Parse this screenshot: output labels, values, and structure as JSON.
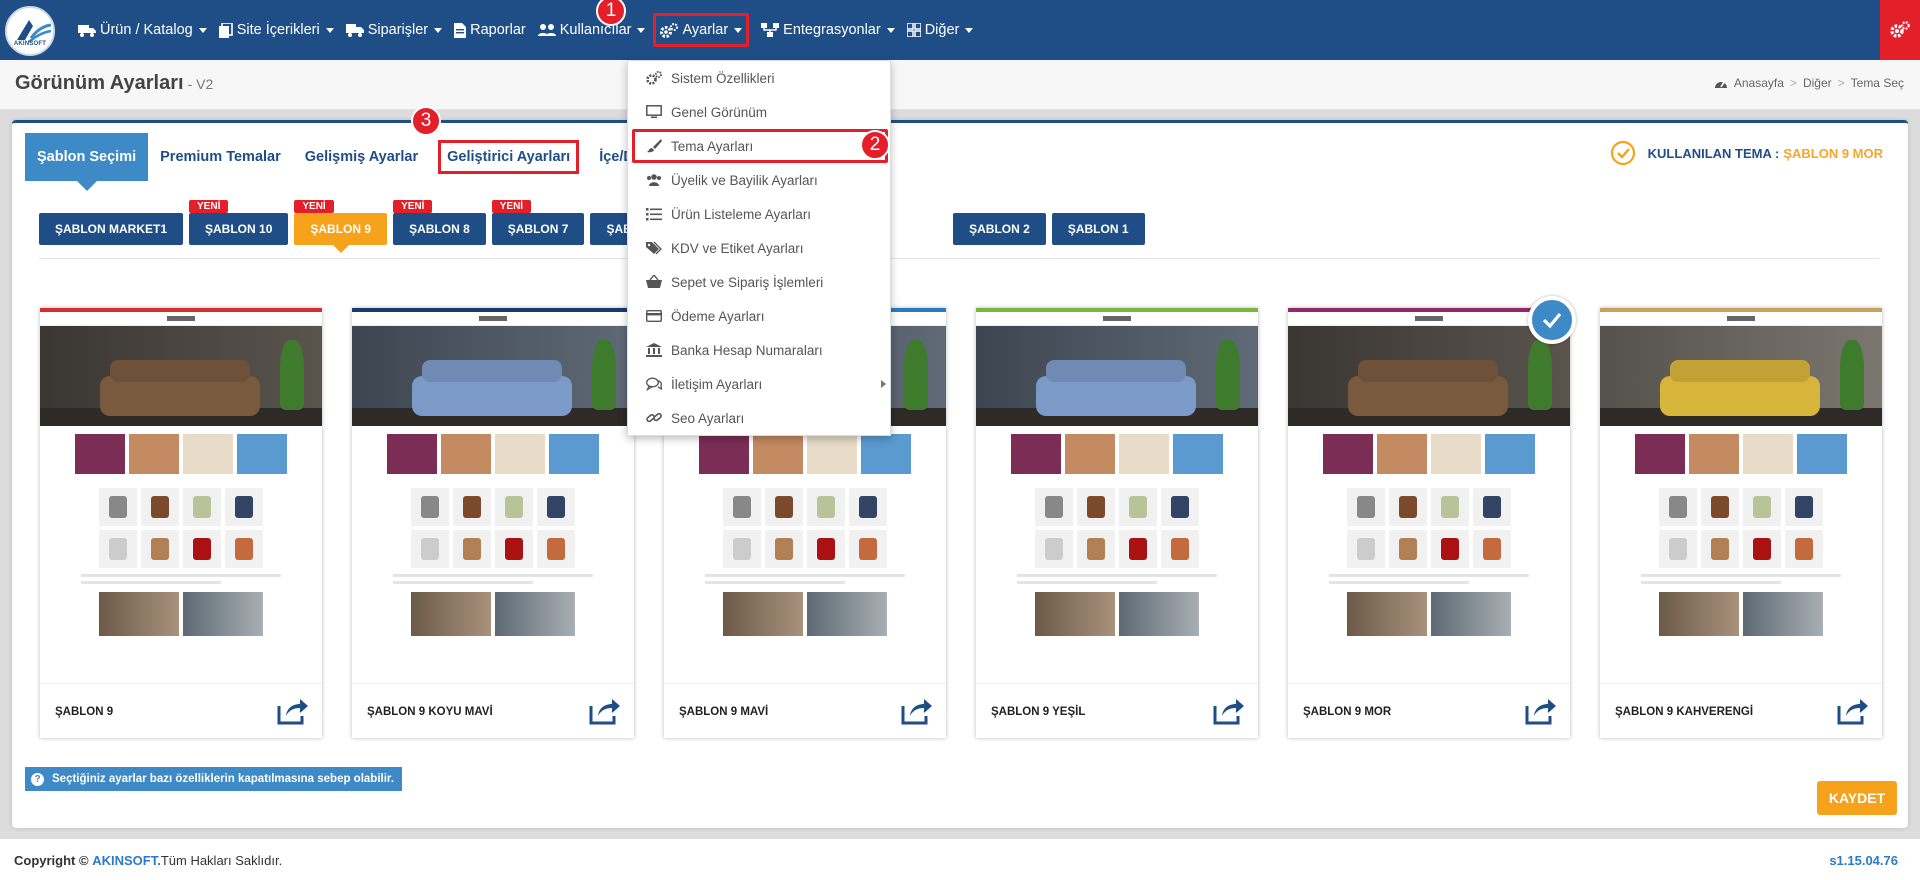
{
  "nav": {
    "logo_text": "AKINSOFT",
    "items": [
      {
        "label": "Ürün / Katalog"
      },
      {
        "label": "Site İçerikleri"
      },
      {
        "label": "Siparişler"
      },
      {
        "label": "Raporlar"
      },
      {
        "label": "Kullanıcılar"
      },
      {
        "label": "Ayarlar"
      },
      {
        "label": "Entegrasyonlar"
      },
      {
        "label": "Diğer"
      }
    ]
  },
  "page": {
    "title": "Görünüm Ayarları",
    "version_tag": "- V2"
  },
  "breadcrumb": [
    "Anasayfa",
    "Diğer",
    "Tema Seç"
  ],
  "tabs": [
    {
      "label": "Şablon Seçimi"
    },
    {
      "label": "Premium Temalar"
    },
    {
      "label": "Gelişmiş Ayarlar"
    },
    {
      "label": "Geliştirici Ayarları"
    },
    {
      "label": "İçe/Dışa"
    }
  ],
  "active_theme": {
    "label": "KULLANILAN TEMA :",
    "value": "ŞABLON 9 MOR"
  },
  "template_buttons": [
    {
      "label": "ŞABLON MARKET1",
      "badge": ""
    },
    {
      "label": "ŞABLON 10",
      "badge": "YENİ"
    },
    {
      "label": "ŞABLON 9",
      "badge": "YENİ"
    },
    {
      "label": "ŞABLON 8",
      "badge": "YENİ"
    },
    {
      "label": "ŞABLON 7",
      "badge": "YENİ"
    },
    {
      "label": "ŞABLON 6",
      "badge": ""
    },
    {
      "label": "ŞABLON 2",
      "badge": ""
    },
    {
      "label": "ŞABLON 1",
      "badge": ""
    }
  ],
  "cards": [
    {
      "name": "ŞABLON 9",
      "accent": "#d32f2f"
    },
    {
      "name": "ŞABLON 9 KOYU MAVİ",
      "accent": "#1a3a6b"
    },
    {
      "name": "ŞABLON 9 MAVİ",
      "accent": "#2a7ac6"
    },
    {
      "name": "ŞABLON 9 YEŞİL",
      "accent": "#7cb342"
    },
    {
      "name": "ŞABLON 9 MOR",
      "accent": "#8e2a6b"
    },
    {
      "name": "ŞABLON 9 KAHVERENGİ",
      "accent": "#c9a15b"
    }
  ],
  "info_text": "Seçtiğiniz ayarlar bazı özelliklerin kapatılmasına sebep olabilir.",
  "save_label": "KAYDET",
  "footer": {
    "copyright_prefix": "Copyright ©",
    "brand": "AKINSOFT.",
    "rights": "Tüm Hakları Saklıdır.",
    "version": "s1.15.04.76"
  },
  "dropdown": {
    "items": [
      {
        "label": "Sistem Özellikleri",
        "icon": "cogs-icon"
      },
      {
        "label": "Genel Görünüm",
        "icon": "desktop-icon"
      },
      {
        "label": "Tema Ayarları",
        "icon": "paint-brush-icon"
      },
      {
        "label": "Üyelik ve Bayilik Ayarları",
        "icon": "users-icon"
      },
      {
        "label": "Ürün Listeleme Ayarları",
        "icon": "list-icon"
      },
      {
        "label": "KDV ve Etiket Ayarları",
        "icon": "tags-icon"
      },
      {
        "label": "Sepet ve Sipariş İşlemleri",
        "icon": "basket-icon"
      },
      {
        "label": "Ödeme Ayarları",
        "icon": "credit-card-icon"
      },
      {
        "label": "Banka Hesap Numaraları",
        "icon": "bank-icon"
      },
      {
        "label": "İletişim Ayarları",
        "icon": "comments-icon"
      },
      {
        "label": "Seo Ayarları",
        "icon": "link-icon"
      }
    ]
  },
  "annotations": [
    "1",
    "2",
    "3"
  ],
  "colors": {
    "primary": "#1f4e87",
    "accent_orange": "#f7a21b",
    "highlight_red": "#e3202a",
    "tab_blue": "#3d8ac7"
  }
}
